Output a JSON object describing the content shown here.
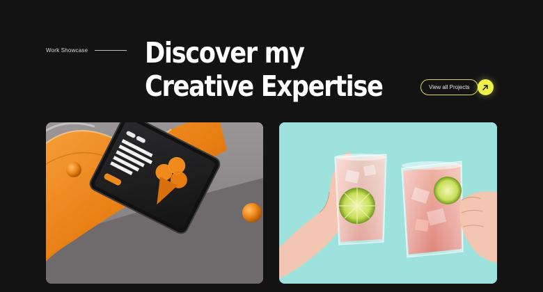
{
  "section": {
    "eyebrow": "Work Showcase",
    "title_line1": "Discover my",
    "title_line2": "Creative Expertise"
  },
  "cta": {
    "label": "View all Projects",
    "icon": "arrow-up-right-icon",
    "accent": "#eef24a"
  },
  "projects": [
    {
      "image": "tablet-mockup-image",
      "screen_text": "Use mockups to make your poster better and more creative"
    },
    {
      "image": "cocktail-toast-image"
    }
  ],
  "colors": {
    "background": "#131314",
    "accent": "#eef24a",
    "orange": "#f08a1c",
    "aqua": "#9ee2de"
  }
}
